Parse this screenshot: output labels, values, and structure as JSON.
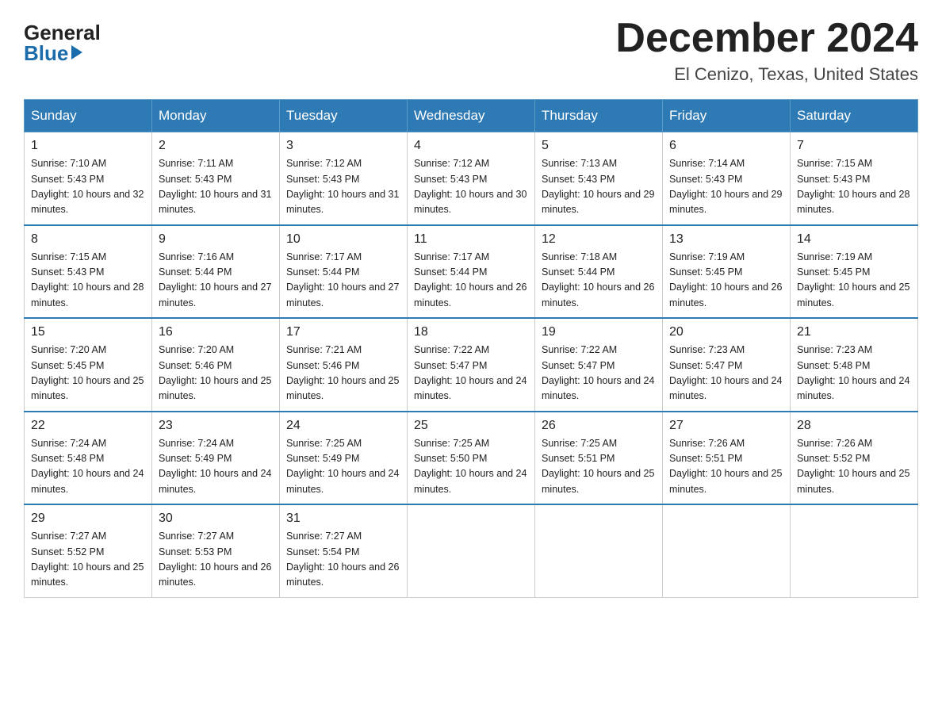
{
  "logo": {
    "general": "General",
    "blue": "Blue"
  },
  "title": "December 2024",
  "location": "El Cenizo, Texas, United States",
  "days_of_week": [
    "Sunday",
    "Monday",
    "Tuesday",
    "Wednesday",
    "Thursday",
    "Friday",
    "Saturday"
  ],
  "weeks": [
    [
      {
        "day": "1",
        "sunrise": "7:10 AM",
        "sunset": "5:43 PM",
        "daylight": "10 hours and 32 minutes."
      },
      {
        "day": "2",
        "sunrise": "7:11 AM",
        "sunset": "5:43 PM",
        "daylight": "10 hours and 31 minutes."
      },
      {
        "day": "3",
        "sunrise": "7:12 AM",
        "sunset": "5:43 PM",
        "daylight": "10 hours and 31 minutes."
      },
      {
        "day": "4",
        "sunrise": "7:12 AM",
        "sunset": "5:43 PM",
        "daylight": "10 hours and 30 minutes."
      },
      {
        "day": "5",
        "sunrise": "7:13 AM",
        "sunset": "5:43 PM",
        "daylight": "10 hours and 29 minutes."
      },
      {
        "day": "6",
        "sunrise": "7:14 AM",
        "sunset": "5:43 PM",
        "daylight": "10 hours and 29 minutes."
      },
      {
        "day": "7",
        "sunrise": "7:15 AM",
        "sunset": "5:43 PM",
        "daylight": "10 hours and 28 minutes."
      }
    ],
    [
      {
        "day": "8",
        "sunrise": "7:15 AM",
        "sunset": "5:43 PM",
        "daylight": "10 hours and 28 minutes."
      },
      {
        "day": "9",
        "sunrise": "7:16 AM",
        "sunset": "5:44 PM",
        "daylight": "10 hours and 27 minutes."
      },
      {
        "day": "10",
        "sunrise": "7:17 AM",
        "sunset": "5:44 PM",
        "daylight": "10 hours and 27 minutes."
      },
      {
        "day": "11",
        "sunrise": "7:17 AM",
        "sunset": "5:44 PM",
        "daylight": "10 hours and 26 minutes."
      },
      {
        "day": "12",
        "sunrise": "7:18 AM",
        "sunset": "5:44 PM",
        "daylight": "10 hours and 26 minutes."
      },
      {
        "day": "13",
        "sunrise": "7:19 AM",
        "sunset": "5:45 PM",
        "daylight": "10 hours and 26 minutes."
      },
      {
        "day": "14",
        "sunrise": "7:19 AM",
        "sunset": "5:45 PM",
        "daylight": "10 hours and 25 minutes."
      }
    ],
    [
      {
        "day": "15",
        "sunrise": "7:20 AM",
        "sunset": "5:45 PM",
        "daylight": "10 hours and 25 minutes."
      },
      {
        "day": "16",
        "sunrise": "7:20 AM",
        "sunset": "5:46 PM",
        "daylight": "10 hours and 25 minutes."
      },
      {
        "day": "17",
        "sunrise": "7:21 AM",
        "sunset": "5:46 PM",
        "daylight": "10 hours and 25 minutes."
      },
      {
        "day": "18",
        "sunrise": "7:22 AM",
        "sunset": "5:47 PM",
        "daylight": "10 hours and 24 minutes."
      },
      {
        "day": "19",
        "sunrise": "7:22 AM",
        "sunset": "5:47 PM",
        "daylight": "10 hours and 24 minutes."
      },
      {
        "day": "20",
        "sunrise": "7:23 AM",
        "sunset": "5:47 PM",
        "daylight": "10 hours and 24 minutes."
      },
      {
        "day": "21",
        "sunrise": "7:23 AM",
        "sunset": "5:48 PM",
        "daylight": "10 hours and 24 minutes."
      }
    ],
    [
      {
        "day": "22",
        "sunrise": "7:24 AM",
        "sunset": "5:48 PM",
        "daylight": "10 hours and 24 minutes."
      },
      {
        "day": "23",
        "sunrise": "7:24 AM",
        "sunset": "5:49 PM",
        "daylight": "10 hours and 24 minutes."
      },
      {
        "day": "24",
        "sunrise": "7:25 AM",
        "sunset": "5:49 PM",
        "daylight": "10 hours and 24 minutes."
      },
      {
        "day": "25",
        "sunrise": "7:25 AM",
        "sunset": "5:50 PM",
        "daylight": "10 hours and 24 minutes."
      },
      {
        "day": "26",
        "sunrise": "7:25 AM",
        "sunset": "5:51 PM",
        "daylight": "10 hours and 25 minutes."
      },
      {
        "day": "27",
        "sunrise": "7:26 AM",
        "sunset": "5:51 PM",
        "daylight": "10 hours and 25 minutes."
      },
      {
        "day": "28",
        "sunrise": "7:26 AM",
        "sunset": "5:52 PM",
        "daylight": "10 hours and 25 minutes."
      }
    ],
    [
      {
        "day": "29",
        "sunrise": "7:27 AM",
        "sunset": "5:52 PM",
        "daylight": "10 hours and 25 minutes."
      },
      {
        "day": "30",
        "sunrise": "7:27 AM",
        "sunset": "5:53 PM",
        "daylight": "10 hours and 26 minutes."
      },
      {
        "day": "31",
        "sunrise": "7:27 AM",
        "sunset": "5:54 PM",
        "daylight": "10 hours and 26 minutes."
      },
      null,
      null,
      null,
      null
    ]
  ]
}
